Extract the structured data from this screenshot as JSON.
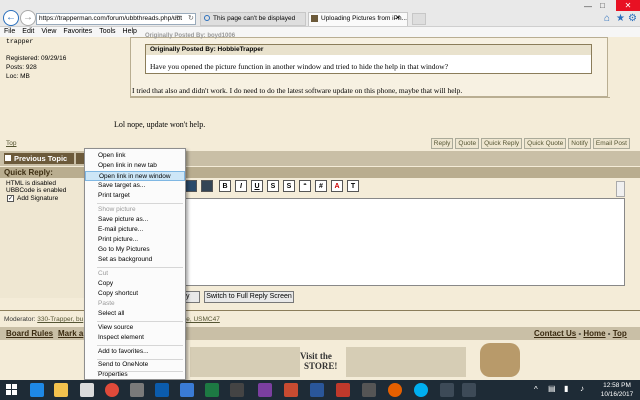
{
  "browser": {
    "address": "https://trapperman.com/forum/ubbthreads.php/ubt",
    "tabs": [
      {
        "label": "This page can't be displayed"
      },
      {
        "label": "Uploading Pictures from iPh..."
      }
    ],
    "menu": [
      "File",
      "Edit",
      "View",
      "Favorites",
      "Tools",
      "Help"
    ]
  },
  "user": {
    "name": "trapper",
    "registered": "Registered: 09/29/16",
    "posts": "Posts: 928",
    "loc": "Loc: MB"
  },
  "post": {
    "quote_cut": "Originally Posted By: boyd1006",
    "quote_header": "Originally Posted By: HobbieTrapper",
    "quote_text": "Have you opened the picture function in another window and tried to hide the help in that window?",
    "reply_text": "I tried that also and didn't work. I do need to do the latest software update on this phone, maybe that will help.",
    "second_text": "Lol nope, update won't help.",
    "top_link": "Top"
  },
  "actions": [
    "Reply",
    "Quote",
    "Quick Reply",
    "Quick Quote",
    "Notify",
    "Email Post"
  ],
  "nav": {
    "prev_topic": "Previous Topic"
  },
  "quick_reply": {
    "title": "Quick Reply:",
    "html_status": "HTML is disabled",
    "ubb_status": "UBBCode is enabled",
    "add_signature": "Add Signature",
    "submit_fragment": "ply",
    "full_editor": "Switch to Full Reply Screen"
  },
  "editor_buttons": [
    "B",
    "I",
    "U",
    "S",
    "S",
    "“",
    "#",
    "A",
    "T"
  ],
  "moderator": {
    "prefix": "Moderator:",
    "names": "330-Trapper, bu",
    "names_end": "schoolie, USMC47"
  },
  "footer": {
    "board_rules": "Board Rules",
    "mark": "Mark a",
    "contact": "Contact Us",
    "home": "Home",
    "top": "Top",
    "sep": " - "
  },
  "store": {
    "line1": "Visit the",
    "line2": "STORE!"
  },
  "context_menu": {
    "items": [
      {
        "label": "Open link",
        "enabled": true
      },
      {
        "label": "Open link in new tab",
        "enabled": true
      },
      {
        "label": "Open link in new window",
        "enabled": true,
        "highlighted": true
      },
      {
        "label": "Save target as...",
        "enabled": true
      },
      {
        "label": "Print target",
        "enabled": true
      },
      {
        "label": "Show picture",
        "enabled": false
      },
      {
        "label": "Save picture as...",
        "enabled": true
      },
      {
        "label": "E-mail picture...",
        "enabled": true
      },
      {
        "label": "Print picture...",
        "enabled": true
      },
      {
        "label": "Go to My Pictures",
        "enabled": true
      },
      {
        "label": "Set as background",
        "enabled": true
      },
      {
        "label": "Cut",
        "enabled": false
      },
      {
        "label": "Copy",
        "enabled": true
      },
      {
        "label": "Copy shortcut",
        "enabled": true
      },
      {
        "label": "Paste",
        "enabled": false
      },
      {
        "label": "Select all",
        "enabled": true
      },
      {
        "label": "View source",
        "enabled": true
      },
      {
        "label": "Inspect element",
        "enabled": true
      },
      {
        "label": "Add to favorites...",
        "enabled": true
      },
      {
        "label": "Send to OneNote",
        "enabled": true
      },
      {
        "label": "Properties",
        "enabled": true
      }
    ]
  },
  "clock": {
    "time": "12:58 PM",
    "date": "10/16/2017"
  },
  "colors": {
    "accent": "#2a6fbd",
    "forum_bg": "#f4ecd8",
    "header_band": "#c9bfa6",
    "taskbar": "#1e2b36",
    "menu_highlight": "#cde6f7"
  }
}
